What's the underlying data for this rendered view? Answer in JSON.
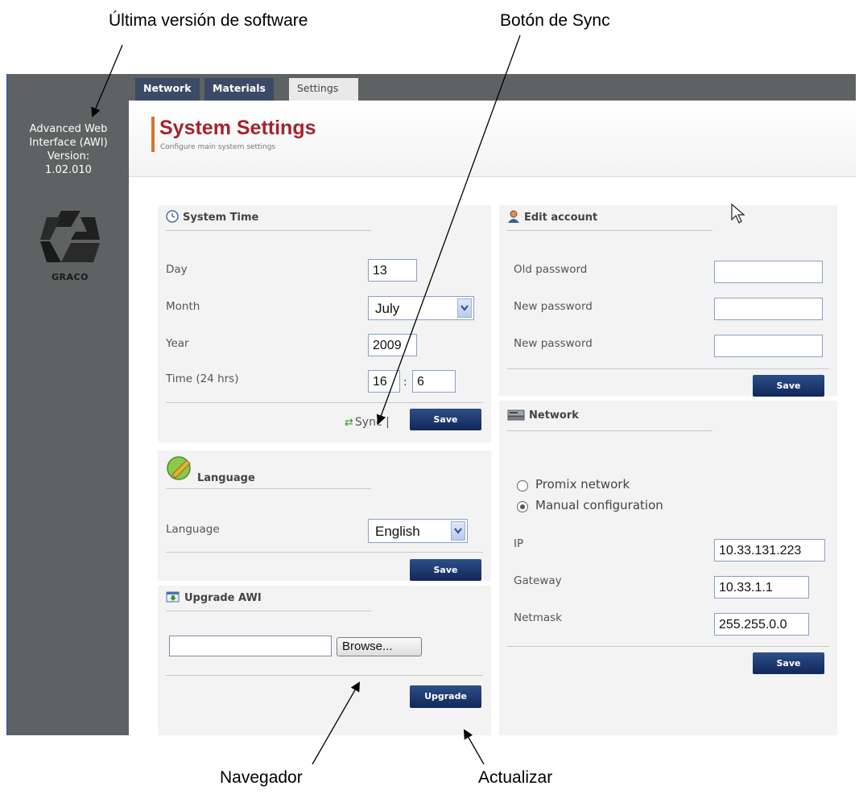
{
  "annotations": {
    "software_version": "Última versión de software",
    "sync_button": "Botón de Sync",
    "browser": "Navegador",
    "update": "Actualizar"
  },
  "sidebar": {
    "version_lines": [
      "Advanced Web",
      "Interface (AWI)",
      "Version:",
      "1.02.010"
    ],
    "logo_text": "GRACO"
  },
  "tabs": [
    "Network",
    "Materials",
    "Settings"
  ],
  "header": {
    "title": "System Settings",
    "subtitle": "Configure main system settings"
  },
  "system_time": {
    "title": "System Time",
    "day_label": "Day",
    "day_value": "13",
    "month_label": "Month",
    "month_value": "July",
    "year_label": "Year",
    "year_value": "2009",
    "time_label": "Time (24 hrs)",
    "hour_value": "16",
    "time_sep": ":",
    "minute_value": "6",
    "sync_label": "Sync |",
    "save_label": "Save"
  },
  "language": {
    "title": "Language",
    "label": "Language",
    "value": "English",
    "save_label": "Save"
  },
  "upgrade": {
    "title": "Upgrade AWI",
    "file_value": "",
    "browse_label": "Browse...",
    "upgrade_label": "Upgrade"
  },
  "edit_account": {
    "title": "Edit account",
    "old_password_label": "Old password",
    "new_password_label": "New password",
    "confirm_password_label": "New password",
    "save_label": "Save"
  },
  "network": {
    "title": "Network",
    "option_promix": "Promix network",
    "option_manual": "Manual configuration",
    "selected_option": "Manual configuration",
    "ip_label": "IP",
    "ip_value": "10.33.131.223",
    "gateway_label": "Gateway",
    "gateway_value": "10.33.1.1",
    "netmask_label": "Netmask",
    "netmask_value": "255.255.0.0",
    "save_label": "Save"
  },
  "colors": {
    "sidebar_bg": "#5f6262",
    "tab_dark": "#3b4a66",
    "title_red": "#a3232d",
    "accent_orange": "#d9732c",
    "button_navy": "#1a3366",
    "panel_bg": "#f3f3f3"
  },
  "icons": [
    "clock-icon",
    "user-icon",
    "sync-icon",
    "network-icon",
    "language-icon",
    "upgrade-icon",
    "chevron-down-icon",
    "mouse-cursor-icon",
    "graco-logo"
  ]
}
